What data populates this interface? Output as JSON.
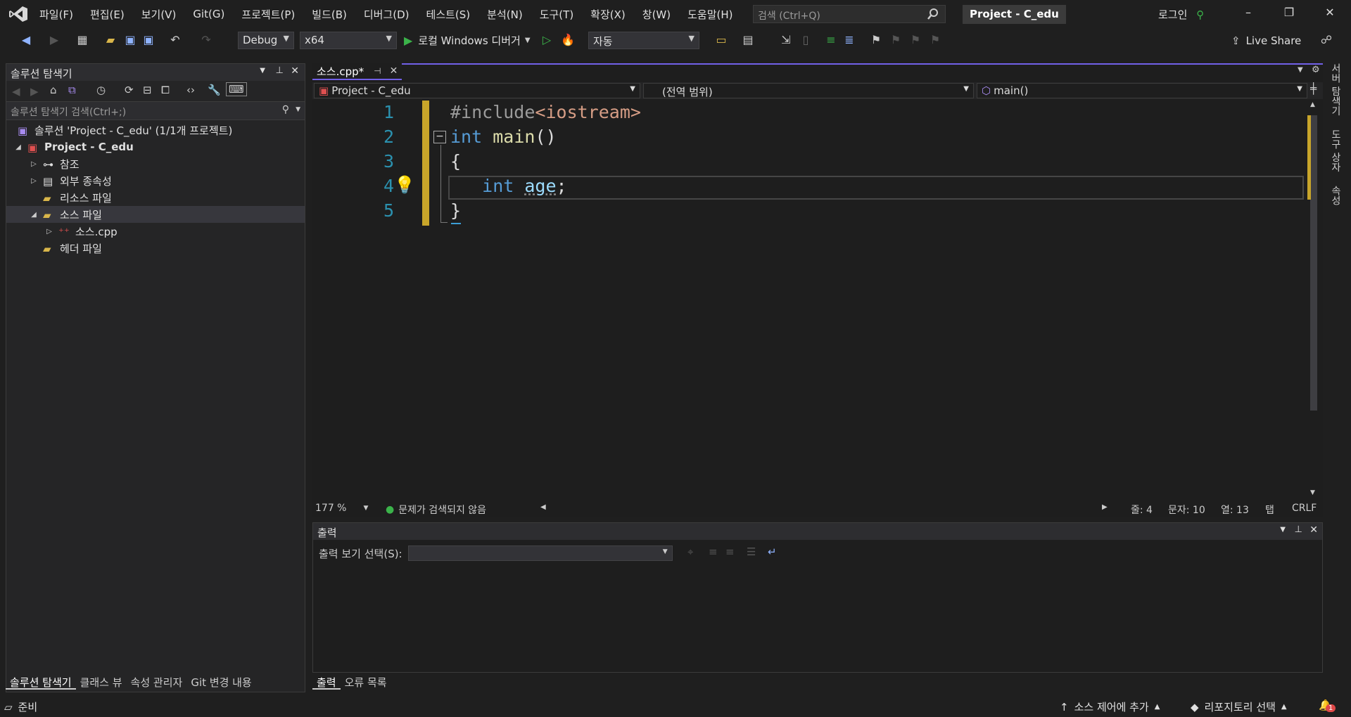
{
  "menubar": {
    "items": [
      "파일(F)",
      "편집(E)",
      "보기(V)",
      "Git(G)",
      "프로젝트(P)",
      "빌드(B)",
      "디버그(D)",
      "테스트(S)",
      "분석(N)",
      "도구(T)",
      "확장(X)",
      "창(W)",
      "도움말(H)"
    ],
    "search_placeholder": "검색 (Ctrl+Q)",
    "project_badge": "Project - C_edu",
    "login": "로그인"
  },
  "toolbar": {
    "config": "Debug",
    "platform": "x64",
    "debugger": "로컬 Windows 디버거",
    "mode": "자동",
    "live_share": "Live Share"
  },
  "solution_explorer": {
    "title": "솔루션 탐색기",
    "search_placeholder": "솔루션 탐색기 검색(Ctrl+;)",
    "tree": [
      {
        "label": "솔루션 'Project - C_edu' (1/1개 프로젝트)"
      },
      {
        "label": "Project - C_edu"
      },
      {
        "label": "참조"
      },
      {
        "label": "외부 종속성"
      },
      {
        "label": "리소스 파일"
      },
      {
        "label": "소스 파일"
      },
      {
        "label": "소스.cpp"
      },
      {
        "label": "헤더 파일"
      }
    ],
    "bottom_tabs": [
      "솔루션 탐색기",
      "클래스 뷰",
      "속성 관리자",
      "Git 변경 내용"
    ]
  },
  "editor": {
    "tab_label": "소스.cpp*",
    "nav": {
      "project": "Project - C_edu",
      "scope": "(전역 범위)",
      "member": "main()"
    },
    "line_numbers": [
      "1",
      "2",
      "3",
      "4",
      "5"
    ],
    "code": {
      "l1_pp": "#include",
      "l1_inc": "<iostream>",
      "l2_kw": "int",
      "l2_fn": "main",
      "l2_rest": "()",
      "l3": "{",
      "l4_kw": "int",
      "l4_var": "age",
      "l4_rest": ";",
      "l5": "}"
    },
    "status": {
      "zoom": "177 %",
      "issues": "문제가 검색되지 않음",
      "line": "줄: 4",
      "char": "문자: 10",
      "col": "열: 13",
      "indent": "탭",
      "eol": "CRLF"
    }
  },
  "output": {
    "title": "출력",
    "source_label": "출력 보기 선택(S):",
    "bottom_tabs": [
      "출력",
      "오류 목록"
    ]
  },
  "right_tabs": [
    "서버 탐색기",
    "도구 상자",
    "속성"
  ],
  "statusbar": {
    "ready": "준비",
    "source_control": "소스 제어에 추가",
    "repo": "리포지토리 선택",
    "notifications": "1"
  },
  "colors": {
    "accent": "#7160e8",
    "change_bar": "#c8a52a",
    "ok": "#3bb34a"
  }
}
